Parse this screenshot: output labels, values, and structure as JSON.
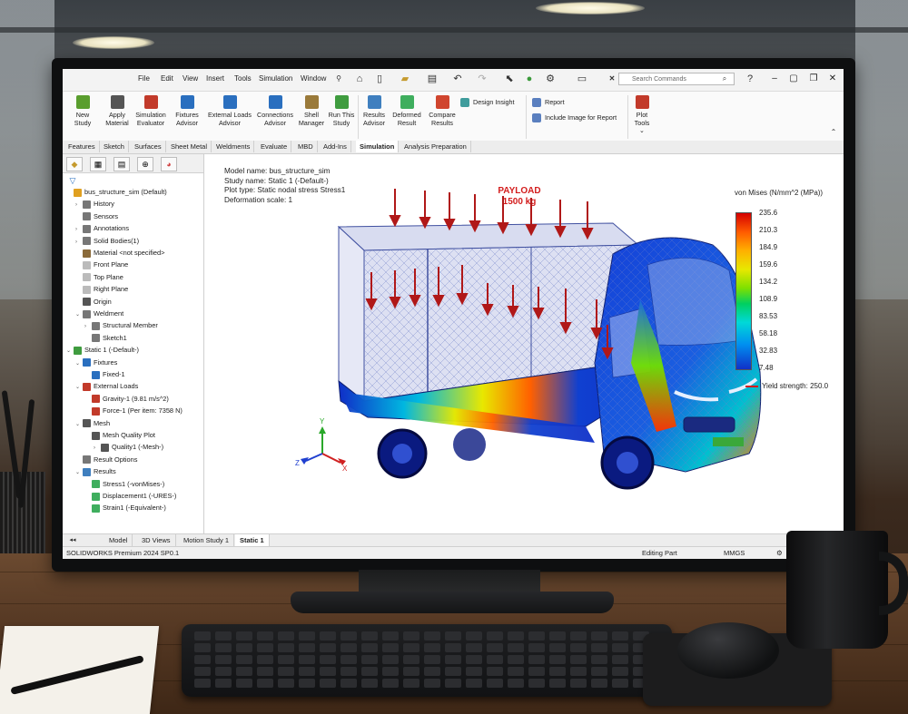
{
  "menu": [
    "File",
    "Edit",
    "View",
    "Insert",
    "Tools",
    "Simulation",
    "Window"
  ],
  "search": {
    "placeholder": "Search Commands"
  },
  "ribbon": {
    "buttons": [
      {
        "label1": "New",
        "label2": "Study",
        "color": "#5a9e2e"
      },
      {
        "label1": "Apply",
        "label2": "Material",
        "color": "#555555"
      },
      {
        "label1": "Simulation",
        "label2": "Evaluator",
        "color": "#c23a2a"
      },
      {
        "label1": "Fixtures",
        "label2": "Advisor",
        "color": "#2a6fbf"
      },
      {
        "label1": "External Loads",
        "label2": "Advisor",
        "color": "#2a6fbf"
      },
      {
        "label1": "Connections",
        "label2": "Advisor",
        "color": "#2a6fbf"
      },
      {
        "label1": "Shell",
        "label2": "Manager",
        "color": "#9a7a3a"
      },
      {
        "label1": "Run This",
        "label2": "Study",
        "color": "#3f9c3f"
      },
      {
        "label1": "Results",
        "label2": "Advisor",
        "color": "#3f7fbf"
      },
      {
        "label1": "Deformed",
        "label2": "Result",
        "color": "#3fae5e"
      },
      {
        "label1": "Compare",
        "label2": "Results",
        "color": "#d0452e"
      }
    ],
    "design_insight": "Design Insight",
    "report": "Report",
    "include_image": "Include Image for Report",
    "plot_tools1": "Plot",
    "plot_tools2": "Tools"
  },
  "tabs": [
    "Features",
    "Sketch",
    "Surfaces",
    "Sheet Metal",
    "Weldments",
    "Evaluate",
    "MBD",
    "Add-Ins",
    "Simulation",
    "Analysis Preparation"
  ],
  "active_tab": "Simulation",
  "tree": [
    {
      "label": "bus_structure_sim (Default)",
      "indent": 0,
      "caret": "",
      "color": "#e0a020"
    },
    {
      "label": "History",
      "indent": 1,
      "caret": "›",
      "color": "#777777"
    },
    {
      "label": "Sensors",
      "indent": 1,
      "caret": "",
      "color": "#777777"
    },
    {
      "label": "Annotations",
      "indent": 1,
      "caret": "›",
      "color": "#777777"
    },
    {
      "label": "Solid Bodies(1)",
      "indent": 1,
      "caret": "›",
      "color": "#777777"
    },
    {
      "label": "Material <not specified>",
      "indent": 1,
      "caret": "",
      "color": "#8a6a3a"
    },
    {
      "label": "Front Plane",
      "indent": 1,
      "caret": "",
      "color": "#bbbbbb"
    },
    {
      "label": "Top Plane",
      "indent": 1,
      "caret": "",
      "color": "#bbbbbb"
    },
    {
      "label": "Right Plane",
      "indent": 1,
      "caret": "",
      "color": "#bbbbbb"
    },
    {
      "label": "Origin",
      "indent": 1,
      "caret": "",
      "color": "#555555"
    },
    {
      "label": "Weldment",
      "indent": 1,
      "caret": "⌄",
      "color": "#777777"
    },
    {
      "label": "Structural Member",
      "indent": 2,
      "caret": "›",
      "color": "#777777"
    },
    {
      "label": "Sketch1",
      "indent": 2,
      "caret": "",
      "color": "#777777"
    },
    {
      "label": "Static 1 (-Default-)",
      "indent": 0,
      "caret": "⌄",
      "color": "#3f9c3f"
    },
    {
      "label": "Fixtures",
      "indent": 1,
      "caret": "⌄",
      "color": "#2a6fbf"
    },
    {
      "label": "Fixed-1",
      "indent": 2,
      "caret": "",
      "color": "#2a6fbf"
    },
    {
      "label": "External Loads",
      "indent": 1,
      "caret": "⌄",
      "color": "#c23a2a"
    },
    {
      "label": "Gravity-1 (9.81 m/s^2)",
      "indent": 2,
      "caret": "",
      "color": "#c23a2a"
    },
    {
      "label": "Force-1 (Per item: 7358 N)",
      "indent": 2,
      "caret": "",
      "color": "#c23a2a"
    },
    {
      "label": "Mesh",
      "indent": 1,
      "caret": "⌄",
      "color": "#555555"
    },
    {
      "label": "Mesh Quality Plot",
      "indent": 2,
      "caret": "",
      "color": "#555555"
    },
    {
      "label": "Quality1 (-Mesh-)",
      "indent": 3,
      "caret": "›",
      "color": "#555555"
    },
    {
      "label": "Result Options",
      "indent": 1,
      "caret": "",
      "color": "#777777"
    },
    {
      "label": "Results",
      "indent": 1,
      "caret": "⌄",
      "color": "#3f7fbf"
    },
    {
      "label": "Stress1 (-vonMises-)",
      "indent": 2,
      "caret": "",
      "color": "#3fae5e"
    },
    {
      "label": "Displacement1 (-URES-)",
      "indent": 2,
      "caret": "",
      "color": "#3fae5e"
    },
    {
      "label": "Strain1 (-Equivalent-)",
      "indent": 2,
      "caret": "",
      "color": "#3fae5e"
    }
  ],
  "info": {
    "model": "Model name: bus_structure_sim",
    "study": "Study name: Static 1 (-Default-)",
    "plot": "Plot type: Static nodal stress Stress1",
    "deform": "Deformation scale: 1"
  },
  "payload": {
    "line1": "PAYLOAD",
    "line2": "1500 kg"
  },
  "legend": {
    "title": "von Mises (N/mm^2 (MPa))",
    "ticks": [
      "235.6",
      "210.3",
      "184.9",
      "159.6",
      "134.2",
      "108.9",
      "83.53",
      "58.18",
      "32.83",
      "7.48"
    ],
    "yield": "Yield strength: 250.0"
  },
  "axes": {
    "x": "X",
    "y": "Y",
    "z": "Z"
  },
  "bottom_tabs": [
    "Model",
    "3D Views",
    "Motion Study 1",
    "Static 1"
  ],
  "status": {
    "product": "SOLIDWORKS Premium 2024 SP0.1",
    "mode": "Editing Part",
    "units": "MMGS"
  },
  "colors": {
    "accent": "#d31d1d",
    "tab_active": "#ffffff"
  }
}
